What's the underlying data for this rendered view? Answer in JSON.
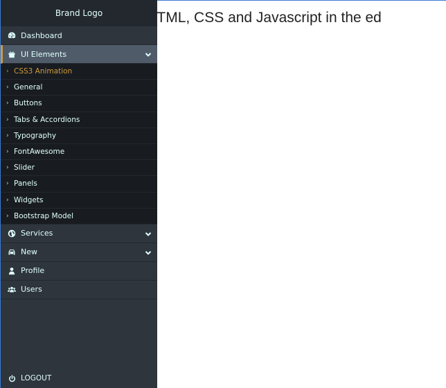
{
  "main": {
    "text": "ppet's HTML, CSS and Javascript in the ed"
  },
  "sidebar": {
    "brand": "Brand Logo",
    "items": [
      {
        "label": "Dashboard",
        "icon": "dashboard-icon"
      },
      {
        "label": "UI Elements",
        "icon": "gift-icon",
        "expanded": true
      },
      {
        "label": "Services",
        "icon": "globe-icon",
        "has_submenu": true
      },
      {
        "label": "New",
        "icon": "car-icon",
        "has_submenu": true
      },
      {
        "label": "Profile",
        "icon": "user-icon"
      },
      {
        "label": "Users",
        "icon": "users-icon"
      }
    ],
    "ui_elements_submenu": [
      "CSS3 Animation",
      "General",
      "Buttons",
      "Tabs & Accordions",
      "Typography",
      "FontAwesome",
      "Slider",
      "Panels",
      "Widgets",
      "Bootstrap Model"
    ],
    "active_submenu": "CSS3 Animation",
    "logout": "LOGOUT"
  },
  "colors": {
    "sidebar_bg": "#2e353d",
    "brand_bg": "#23282e",
    "submenu_bg": "#181c20",
    "active_bg": "#4f5b69",
    "accent": "#d19b3d",
    "text": "#e1ffff"
  }
}
